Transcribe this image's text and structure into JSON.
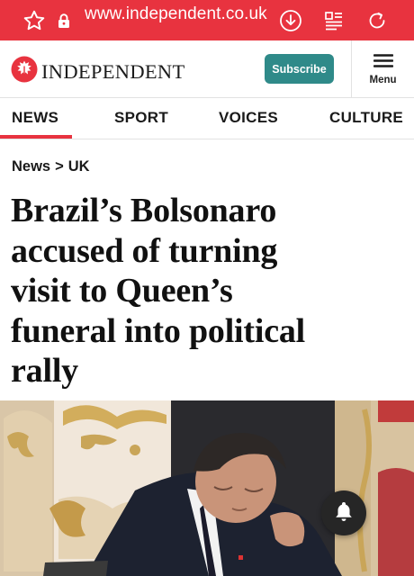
{
  "browser": {
    "url": "www.independent.co.uk",
    "icons": [
      "star-icon",
      "lock-icon",
      "download-icon",
      "reader-mode-icon",
      "reload-icon"
    ],
    "bar_color": "#e8333f"
  },
  "header": {
    "logo_text": "INDEPENDENT",
    "logo_icon": "eagle-icon",
    "subscribe_label": "Subscribe",
    "menu_label": "Menu",
    "accent_color": "#2f8a89"
  },
  "nav": {
    "items": [
      {
        "label": "NEWS",
        "active": true
      },
      {
        "label": "SPORT",
        "active": false
      },
      {
        "label": "VOICES",
        "active": false
      },
      {
        "label": "CULTURE",
        "active": false
      }
    ]
  },
  "breadcrumb": {
    "section": "News",
    "separator": ">",
    "subsection": "UK"
  },
  "article": {
    "headline_lines": [
      "Brazil’s Bolsonaro",
      "accused of turning",
      "visit to Queen’s",
      "funeral into political",
      "rally"
    ]
  },
  "notifications": {
    "icon": "bell-icon"
  }
}
